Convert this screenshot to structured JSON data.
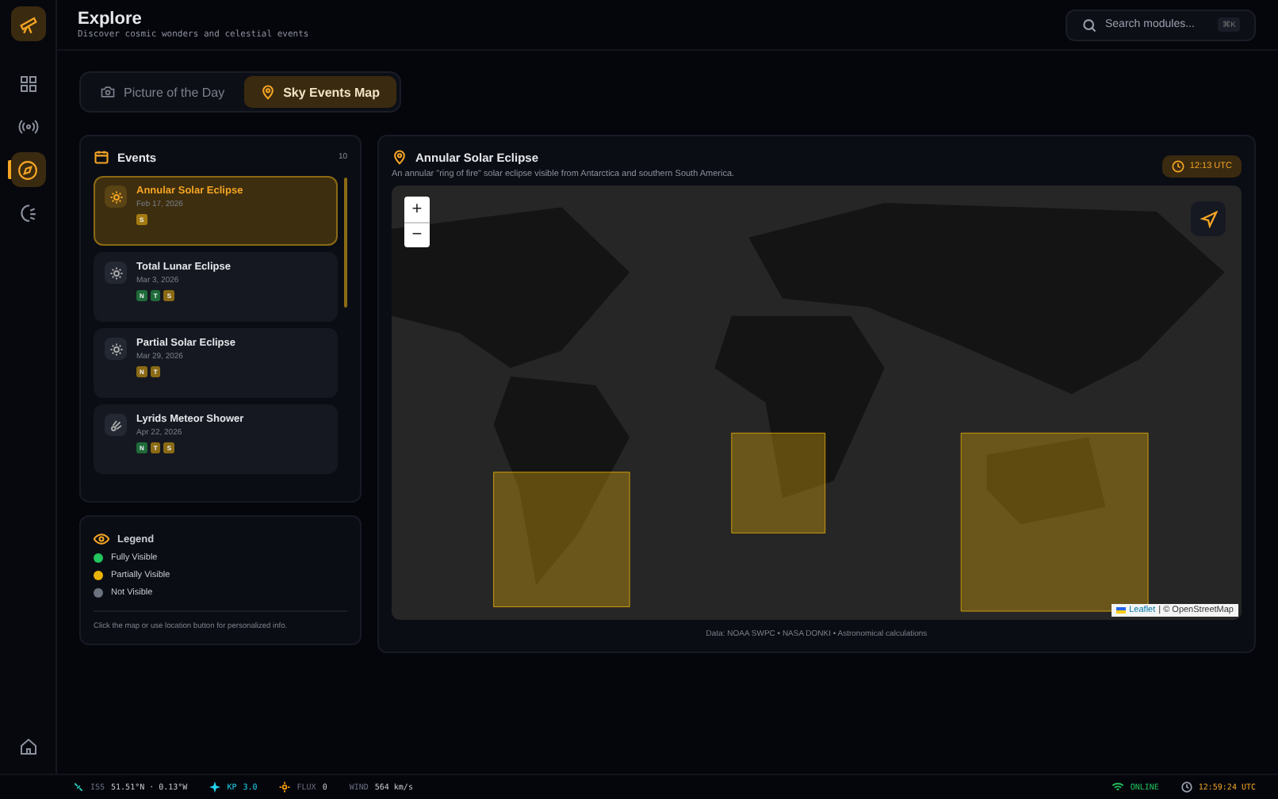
{
  "header": {
    "title": "Explore",
    "subtitle": "Discover cosmic wonders and celestial events",
    "search": {
      "placeholder": "Search modules...",
      "shortcut": "⌘K"
    }
  },
  "nav": [
    {
      "kind": "grid",
      "selected": false
    },
    {
      "kind": "broadcast",
      "selected": false
    },
    {
      "kind": "compass",
      "selected": true
    },
    {
      "kind": "moon",
      "selected": false
    }
  ],
  "tabs": [
    {
      "label": "Picture of the Day",
      "kind": "camera",
      "selected": false
    },
    {
      "label": "Sky Events Map",
      "kind": "pin",
      "selected": true
    }
  ],
  "events": {
    "title": "Events",
    "count": "10",
    "items": [
      {
        "name": "Annular Solar Eclipse",
        "date": "Feb 17, 2026",
        "kind": "sun",
        "selected": true,
        "badges": [
          {
            "label": "S",
            "color": "#a37a12"
          }
        ]
      },
      {
        "name": "Total Lunar Eclipse",
        "date": "Mar 3, 2026",
        "kind": "sun",
        "selected": false,
        "badges": [
          {
            "label": "N",
            "color": "#1f6b3a"
          },
          {
            "label": "T",
            "color": "#1f6b3a"
          },
          {
            "label": "S",
            "color": "#8a6a14"
          }
        ]
      },
      {
        "name": "Partial Solar Eclipse",
        "date": "Mar 29, 2026",
        "kind": "sun",
        "selected": false,
        "badges": [
          {
            "label": "N",
            "color": "#8a6a14"
          },
          {
            "label": "T",
            "color": "#8a6a14"
          }
        ]
      },
      {
        "name": "Lyrids Meteor Shower",
        "date": "Apr 22, 2026",
        "kind": "meteor",
        "selected": false,
        "badges": [
          {
            "label": "N",
            "color": "#1f6b3a"
          },
          {
            "label": "T",
            "color": "#8a6a14"
          },
          {
            "label": "S",
            "color": "#8a6a14"
          }
        ]
      }
    ]
  },
  "legend": {
    "title": "Legend",
    "items": [
      {
        "label": "Fully Visible",
        "color": "#22c55e"
      },
      {
        "label": "Partially Visible",
        "color": "#eab308"
      },
      {
        "label": "Not Visible",
        "color": "#6b7280"
      }
    ],
    "note": "Click the map or use location button for personalized info."
  },
  "map_panel": {
    "title": "Annular Solar Eclipse",
    "description": "An annular \"ring of fire\" solar eclipse visible from Antarctica and southern South America.",
    "time": "12:13 UTC",
    "zoom_in": "+",
    "zoom_out": "−",
    "attribution_link": "Leaflet",
    "attribution": "| © OpenStreetMap",
    "source": "Data: NOAA SWPC • NASA DONKI • Astronomical calculations"
  },
  "status_bar": {
    "iss_label": "ISS",
    "iss": "51.51°N · 0.13°W",
    "kp_label": "KP",
    "kp": "3.0",
    "flux_label": "FLUX",
    "flux": "0",
    "wind_label": "WIND",
    "wind": "564 km/s",
    "connection": "ONLINE",
    "clock": "12:59:24 UTC"
  }
}
